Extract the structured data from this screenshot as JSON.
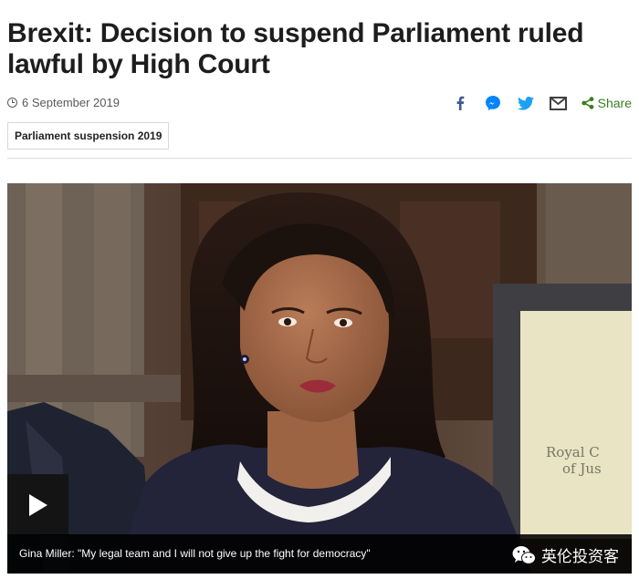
{
  "article": {
    "headline": "Brexit: Decision to suspend Parliament ruled lawful by High Court",
    "date": "6 September 2019",
    "tag": "Parliament suspension 2019"
  },
  "share": {
    "icons": [
      "facebook-icon",
      "messenger-icon",
      "twitter-icon",
      "email-icon"
    ],
    "share_label": "Share",
    "colors": {
      "facebook": "#3b5998",
      "messenger": "#0084ff",
      "twitter": "#1da1f2",
      "email": "#404040",
      "share": "#3b7d23"
    }
  },
  "media": {
    "caption": "Gina Miller: \"My legal team and I will not give up the fight for democracy\"",
    "watermark": "英伦投资客",
    "sign_text": "Royal Courts of Justice"
  }
}
